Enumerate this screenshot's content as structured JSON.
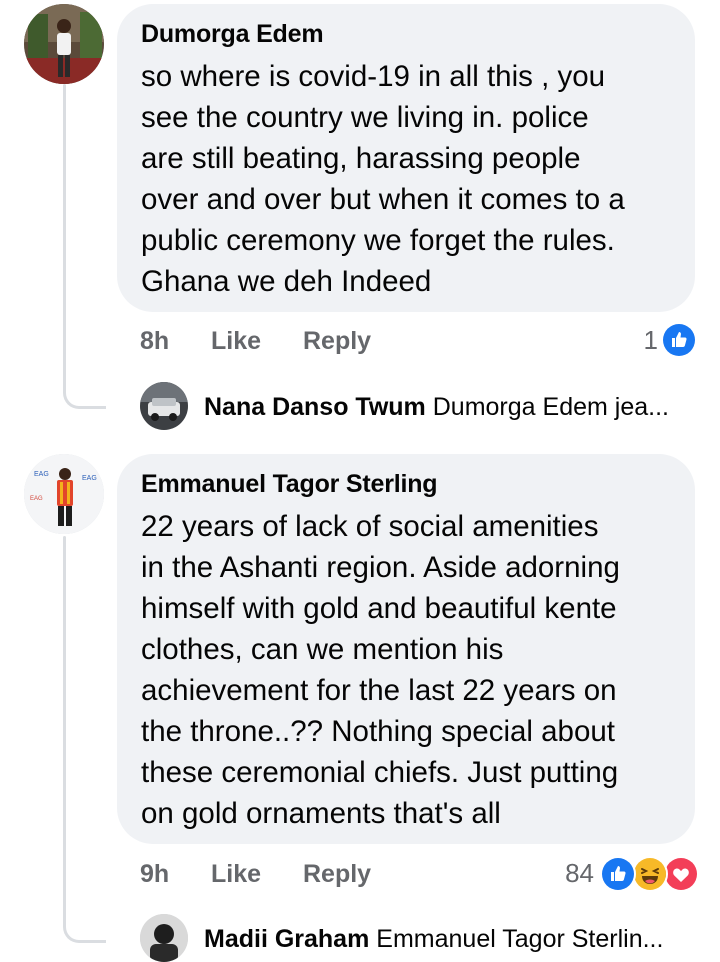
{
  "comments": [
    {
      "author": "Dumorga Edem",
      "text": "so where is covid-19 in all this , you\nsee the country we living in. police\nare still beating, harassing people\nover and over but when it comes to a\npublic ceremony we forget the rules.\nGhana we deh Indeed",
      "time": "8h",
      "like_label": "Like",
      "reply_label": "Reply",
      "reaction_count": "1",
      "reactions": [
        "like-icon"
      ],
      "reply_preview": {
        "author": "Nana Danso Twum",
        "text": "Dumorga Edem jea..."
      }
    },
    {
      "author": "Emmanuel Tagor Sterling",
      "text": "22 years of lack of social amenities\nin the Ashanti region. Aside adorning\nhimself with gold and beautiful kente\nclothes, can we mention his\nachievement for the last 22 years on\nthe throne..?? Nothing special about\nthese ceremonial chiefs. Just putting\non gold ornaments that's all",
      "time": "9h",
      "like_label": "Like",
      "reply_label": "Reply",
      "reaction_count": "84",
      "reactions": [
        "like-icon",
        "haha-icon",
        "love-icon"
      ],
      "reply_preview": {
        "author": "Madii Graham",
        "text": "Emmanuel Tagor Sterlin..."
      }
    }
  ],
  "colors": {
    "bubble": "#f0f2f5",
    "secondary_text": "#65676b",
    "like_blue": "#1877f2",
    "love_red": "#f33e58",
    "haha_yellow": "#f7b928"
  }
}
